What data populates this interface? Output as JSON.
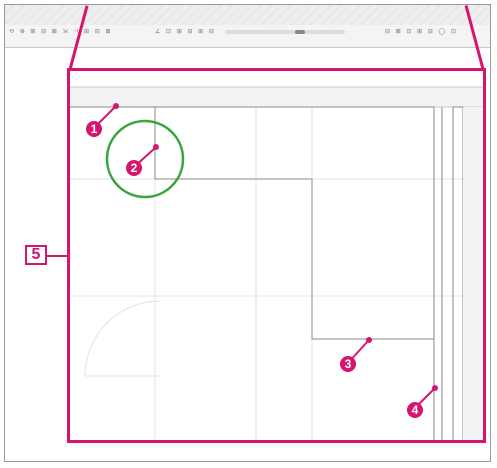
{
  "toolbar": {
    "row1_glyphs": "↰ ⊞ ⊟ ⊠ ⊡ ≡ ≡  ⊡ ⊞ ≡",
    "row2_left_glyphs": "⟲ ⊕ ⊞ ⊟ ⊠ ⇲ ⊣  ⊞ ⊟ ⊠",
    "row2_mid_glyphs": "∠ ⊡ ⊞ ⊟ ⊞ ⊟",
    "row2_right_glyphs": "⊟ ⊠ ⊡ ⊞ ⊟ ◯ ⊡"
  },
  "callout_label": "5",
  "markers": [
    "1",
    "2",
    "3",
    "4"
  ],
  "colors": {
    "accent": "#d6156f",
    "highlight": "#3aa53a"
  }
}
